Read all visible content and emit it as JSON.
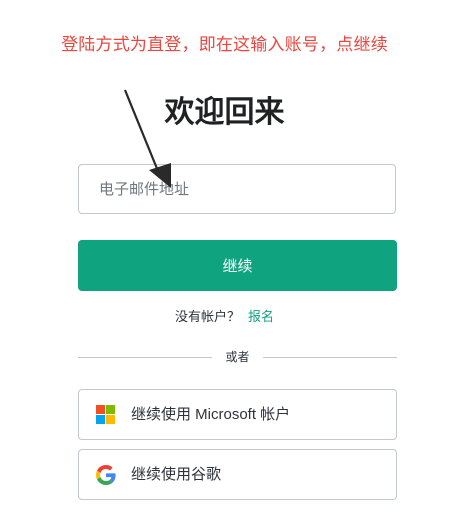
{
  "annotation": {
    "text": "登陆方式为直登，即在这输入账号，点继续",
    "color": "#e8473f"
  },
  "page": {
    "title": "欢迎回来"
  },
  "email": {
    "placeholder": "电子邮件地址",
    "value": ""
  },
  "continue_button": {
    "label": "继续",
    "color": "#10a37f"
  },
  "signup": {
    "prompt": "没有帐户？",
    "link_label": "报名"
  },
  "divider": {
    "label": "或者"
  },
  "social": {
    "microsoft": {
      "label": "继续使用 Microsoft 帐户",
      "icon": "microsoft-logo-icon",
      "colors": [
        "#f25022",
        "#7fba00",
        "#00a4ef",
        "#ffb900"
      ]
    },
    "google": {
      "label": "继续使用谷歌",
      "icon": "google-logo-icon"
    }
  }
}
